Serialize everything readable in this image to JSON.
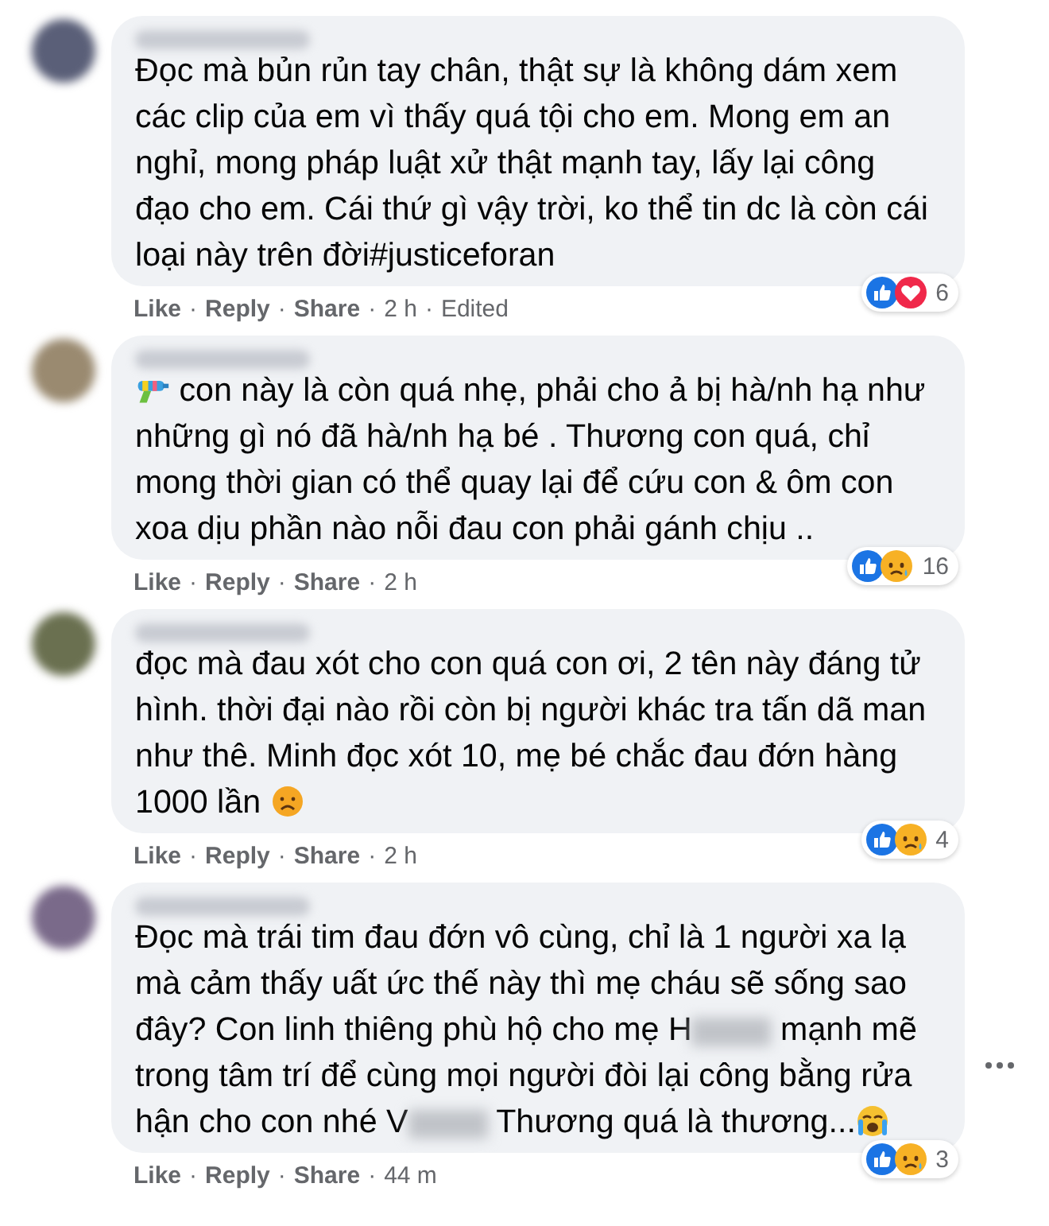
{
  "separator": "·",
  "comments": [
    {
      "body": [
        {
          "kind": "text",
          "text": "Đọc mà bủn rủn tay chân, thật sự là không dám xem các clip của em vì thấy quá tội cho em. Mong em an nghỉ, mong pháp luật xử thật mạnh tay, lấy lại công đạo cho em. Cái thứ gì vậy trời, ko thể tin dc là còn cái loại này trên đời#justiceforan"
        }
      ],
      "actions": [
        {
          "kind": "link",
          "label": "Like"
        },
        {
          "kind": "link",
          "label": "Reply"
        },
        {
          "kind": "link",
          "label": "Share"
        },
        {
          "kind": "meta",
          "label": "2 h"
        },
        {
          "kind": "meta",
          "label": "Edited"
        }
      ],
      "reactions": {
        "icons": [
          {
            "kind": "like"
          },
          {
            "kind": "love"
          }
        ],
        "count": "6"
      },
      "show_options": false
    },
    {
      "body": [
        {
          "kind": "water-gun"
        },
        {
          "kind": "text",
          "text": " con này là còn quá nhẹ, phải cho ả bị hà/nh hạ như những gì nó đã hà/nh hạ bé . Thương con quá, chỉ mong thời gian có thể quay lại để cứu con & ôm con xoa dịu phần nào nỗi đau con phải gánh chịu .."
        }
      ],
      "actions": [
        {
          "kind": "link",
          "label": "Like"
        },
        {
          "kind": "link",
          "label": "Reply"
        },
        {
          "kind": "link",
          "label": "Share"
        },
        {
          "kind": "meta",
          "label": "2 h"
        }
      ],
      "reactions": {
        "icons": [
          {
            "kind": "like"
          },
          {
            "kind": "sad"
          }
        ],
        "count": "16"
      },
      "show_options": false
    },
    {
      "body": [
        {
          "kind": "text",
          "text": "đọc mà đau xót cho con quá con ơi, 2 tên này đáng tử hình. thời đại nào rồi còn bị người khác tra tấn dã man như thê. Minh đọc xót 10, mẹ bé chắc đau đớn hàng 1000 lần "
        },
        {
          "kind": "sad"
        }
      ],
      "actions": [
        {
          "kind": "link",
          "label": "Like"
        },
        {
          "kind": "link",
          "label": "Reply"
        },
        {
          "kind": "link",
          "label": "Share"
        },
        {
          "kind": "meta",
          "label": "2 h"
        }
      ],
      "reactions": {
        "icons": [
          {
            "kind": "like"
          },
          {
            "kind": "sad"
          }
        ],
        "count": "4"
      },
      "show_options": false
    },
    {
      "body": [
        {
          "kind": "text",
          "text": "Đọc mà trái tim đau đớn vô cùng, chỉ là 1 người xa lạ mà cảm thấy uất ức thế này thì mẹ cháu sẽ sống sao đây? Con linh thiêng phù hộ cho mẹ H"
        },
        {
          "kind": "blur"
        },
        {
          "kind": "text",
          "text": " mạnh mẽ trong tâm trí để cùng mọi người đòi lại công bằng rửa hận cho con nhé V"
        },
        {
          "kind": "blur"
        },
        {
          "kind": "text",
          "text": " Thương quá là thương..."
        },
        {
          "kind": "crying"
        }
      ],
      "actions": [
        {
          "kind": "link",
          "label": "Like"
        },
        {
          "kind": "link",
          "label": "Reply"
        },
        {
          "kind": "link",
          "label": "Share"
        },
        {
          "kind": "meta",
          "label": "44 m"
        }
      ],
      "reactions": {
        "icons": [
          {
            "kind": "like"
          },
          {
            "kind": "sad"
          }
        ],
        "count": "3"
      },
      "show_options": true
    }
  ]
}
